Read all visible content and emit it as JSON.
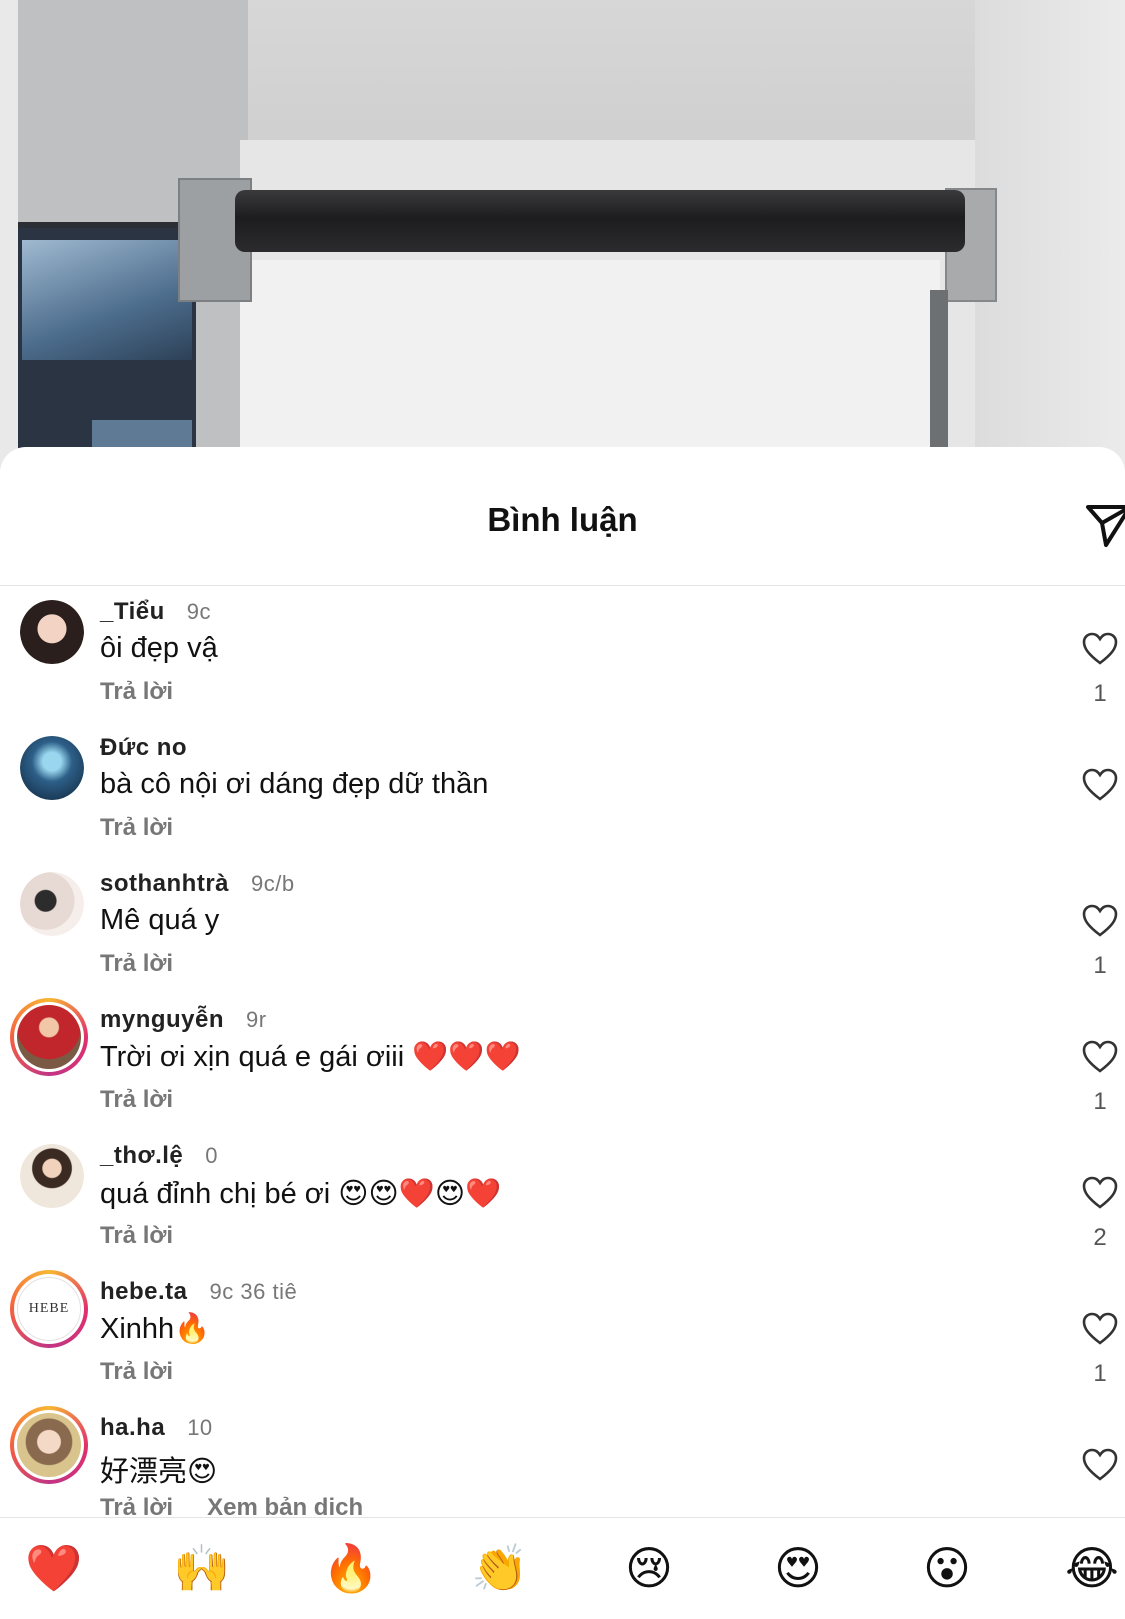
{
  "sheet": {
    "title": "Bình luận"
  },
  "comments": [
    {
      "username": "_Tiểu",
      "time": "9c",
      "text": "ôi đẹp vậ",
      "reply": "Trả lời",
      "likes": "1"
    },
    {
      "username": "Đức no",
      "time": "",
      "text": "bà cô nội ơi dáng đẹp dữ thần",
      "reply": "Trả lời",
      "likes": ""
    },
    {
      "username": "sothanhtrà",
      "time": "9c/b",
      "text": "Mê quá y",
      "reply": "Trả lời",
      "likes": "1"
    },
    {
      "username": "mynguyễn",
      "time": "9r",
      "text": "Trời ơi xịn quá e gái ơiii ❤️❤️❤️",
      "reply": "Trả lời",
      "likes": "1"
    },
    {
      "username": "_thơ.lệ",
      "time": "0",
      "text": "quá đỉnh chị bé ơi 😍😍❤️😍❤️",
      "reply": "Trả lời",
      "likes": "2"
    },
    {
      "username": "hebe.ta",
      "time": "9c 36 tiê",
      "text": "Xinhh🔥",
      "reply": "Trả lời",
      "likes": "1"
    },
    {
      "username": "ha.ha",
      "time": "10",
      "text": "好漂亮😍",
      "reply": "Trả lời",
      "translate": "Xem bản dịch",
      "likes": ""
    }
  ],
  "avatar_labels": {
    "brand": "HEBE"
  },
  "emoji_bar": [
    "❤️",
    "🙌",
    "🔥",
    "👏",
    "😢",
    "😍",
    "😮",
    "😂"
  ],
  "colors": {
    "title": "#111111",
    "secondary": "#777777",
    "story_ring": "#e1306c"
  }
}
